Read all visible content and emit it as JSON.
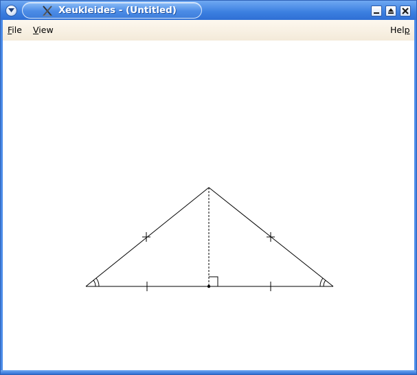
{
  "window": {
    "title": "Xeukleides - (Untitled)",
    "colors": {
      "titlebar": "#3b7fe0",
      "menubar": "#f3ead9",
      "canvas": "#ffffff"
    }
  },
  "titlebar_buttons": {
    "window_menu_icon": "chevron-down-icon",
    "minimize_icon": "minimize-icon",
    "maximize_icon": "maximize-icon",
    "close_icon": "close-icon"
  },
  "menubar": {
    "file": {
      "underlined": "F",
      "rest": "ile"
    },
    "view": {
      "underlined": "V",
      "rest": "iew"
    },
    "help": {
      "rest": "Hel",
      "underlined": "p"
    }
  },
  "figure": {
    "description_icon": "isosceles-triangle-with-altitude",
    "stroke_color": "#000000"
  }
}
